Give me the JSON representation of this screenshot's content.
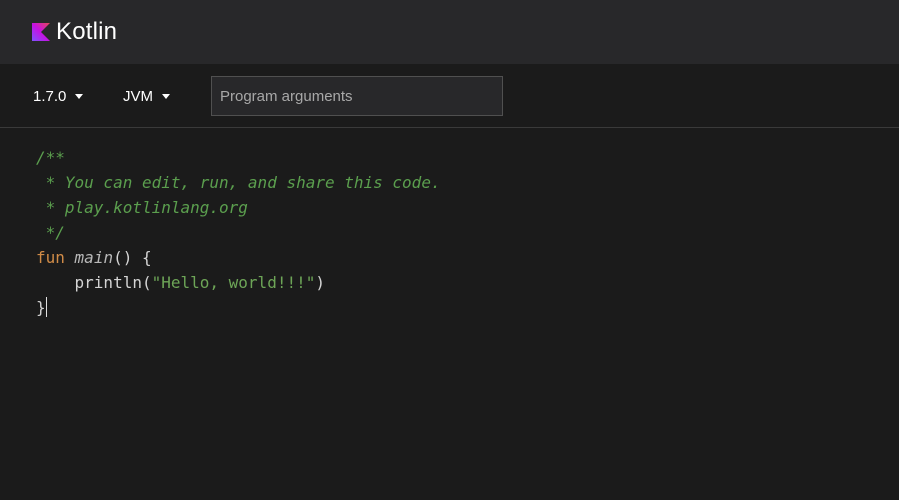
{
  "header": {
    "brand": "Kotlin",
    "logo_icon": "kotlin-logo-icon",
    "brand_color_start": "#7f52ff",
    "brand_color_end": "#c711e1"
  },
  "toolbar": {
    "version": {
      "selected": "1.7.0",
      "icon": "caret-down-icon"
    },
    "target": {
      "selected": "JVM",
      "icon": "caret-down-icon"
    },
    "program_arguments": {
      "placeholder": "Program arguments",
      "value": ""
    }
  },
  "editor": {
    "lines": [
      {
        "tokens": [
          {
            "type": "comment",
            "text": "/**"
          }
        ]
      },
      {
        "tokens": [
          {
            "type": "comment",
            "text": " * You can edit, run, and share this code."
          }
        ]
      },
      {
        "tokens": [
          {
            "type": "comment",
            "text": " * play.kotlinlang.org"
          }
        ]
      },
      {
        "tokens": [
          {
            "type": "comment",
            "text": " */"
          }
        ]
      },
      {
        "tokens": [
          {
            "type": "keyword",
            "text": "fun"
          },
          {
            "type": "plain",
            "text": " "
          },
          {
            "type": "fn",
            "text": "main"
          },
          {
            "type": "plain",
            "text": "() {"
          }
        ]
      },
      {
        "tokens": [
          {
            "type": "plain",
            "text": "    println("
          },
          {
            "type": "string",
            "text": "\"Hello, world!!!\""
          },
          {
            "type": "plain",
            "text": ")"
          }
        ]
      },
      {
        "tokens": [
          {
            "type": "plain",
            "text": "}"
          }
        ],
        "cursor": true
      }
    ],
    "colors": {
      "comment": "#5b9f4e",
      "keyword": "#d08b47",
      "string": "#6da557",
      "plain": "#d4d4d4"
    }
  }
}
